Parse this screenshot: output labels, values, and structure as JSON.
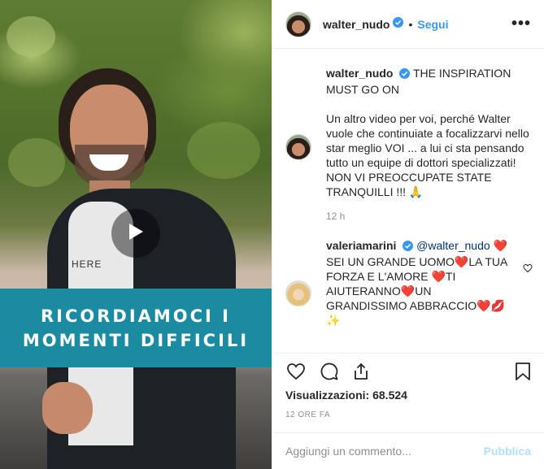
{
  "video": {
    "banner_line1": "RICORDIAMOCI I",
    "banner_line2": "MOMENTI DIFFICILI",
    "shirt_text": "HERE",
    "banner_color": "#1a8ba1"
  },
  "header": {
    "username": "walter_nudo",
    "follow_label": "Segui",
    "more_label": "•••"
  },
  "caption": {
    "username": "walter_nudo",
    "title": "THE INSPIRATION MUST GO ON",
    "body_line1": "Un altro video per voi, perché Walter vuole che continuiate a focalizzarvi nello star meglio VOI ... a lui ci sta pensando tutto un equipe di dottori specializzati!",
    "body_line2": "NON VI PREOCCUPATE STATE TRANQUILLI !!! 🙏",
    "time": "12 h"
  },
  "reply": {
    "username": "valeriamarini",
    "mention": "@walter_nudo",
    "text": "❤️SEI UN GRANDE UOMO❤️LA TUA FORZA E L'AMORE ❤️TI AIUTERANNO❤️UN GRANDISSIMO ABBRACCIO❤️💋✨"
  },
  "stats": {
    "views_label": "Visualizzazioni:",
    "views_value": "68.524",
    "date": "12 ORE FA"
  },
  "add_comment": {
    "placeholder": "Aggiungi un commento...",
    "post_label": "Pubblica"
  },
  "colors": {
    "link": "#3897f0",
    "verified": "#3897f0",
    "muted": "#8e8e8e",
    "post_disabled": "#b2dffc"
  },
  "icons": [
    "play-icon",
    "verified-icon",
    "heart-icon",
    "comment-icon",
    "share-icon",
    "bookmark-icon",
    "more-icon"
  ]
}
